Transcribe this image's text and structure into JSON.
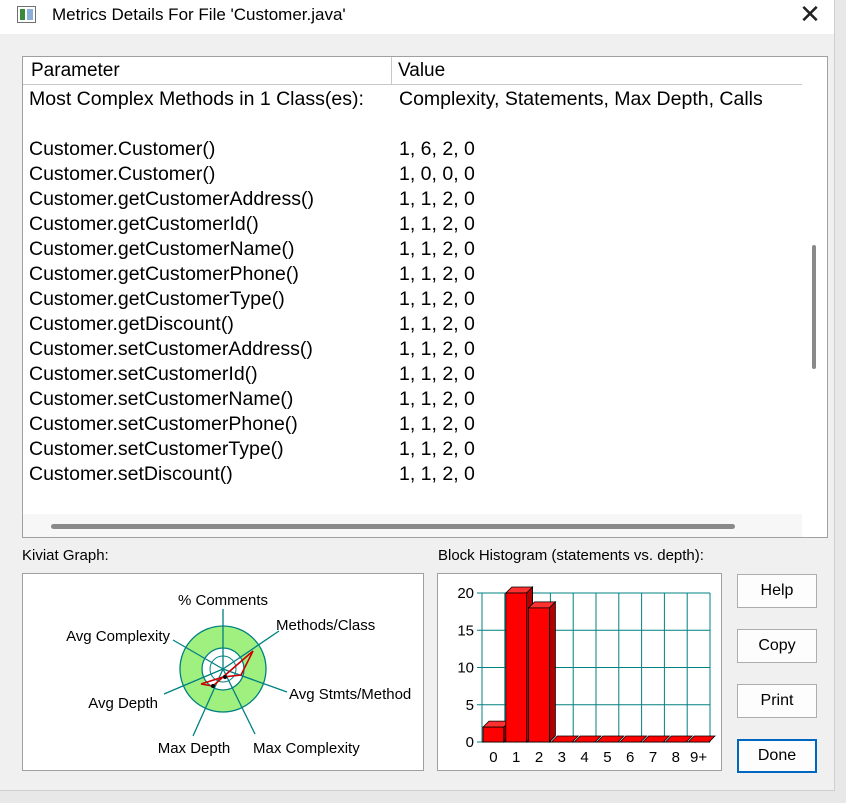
{
  "window": {
    "title": "Metrics Details For File 'Customer.java'",
    "close_glyph": "✕"
  },
  "table": {
    "headers": [
      "Parameter",
      "Value"
    ],
    "rows": [
      {
        "param": "Most Complex Methods in 1 Class(es):",
        "value": "Complexity, Statements, Max Depth, Calls"
      },
      {
        "param": "",
        "value": ""
      },
      {
        "param": "Customer.Customer()",
        "value": "1, 6, 2, 0"
      },
      {
        "param": "Customer.Customer()",
        "value": "1, 0, 0, 0"
      },
      {
        "param": "Customer.getCustomerAddress()",
        "value": "1, 1, 2, 0"
      },
      {
        "param": "Customer.getCustomerId()",
        "value": "1, 1, 2, 0"
      },
      {
        "param": "Customer.getCustomerName()",
        "value": "1, 1, 2, 0"
      },
      {
        "param": "Customer.getCustomerPhone()",
        "value": "1, 1, 2, 0"
      },
      {
        "param": "Customer.getCustomerType()",
        "value": "1, 1, 2, 0"
      },
      {
        "param": "Customer.getDiscount()",
        "value": "1, 1, 2, 0"
      },
      {
        "param": "Customer.setCustomerAddress()",
        "value": "1, 1, 2, 0"
      },
      {
        "param": "Customer.setCustomerId()",
        "value": "1, 1, 2, 0"
      },
      {
        "param": "Customer.setCustomerName()",
        "value": "1, 1, 2, 0"
      },
      {
        "param": "Customer.setCustomerPhone()",
        "value": "1, 1, 2, 0"
      },
      {
        "param": "Customer.setCustomerType()",
        "value": "1, 1, 2, 0"
      },
      {
        "param": "Customer.setDiscount()",
        "value": "1, 1, 2, 0"
      }
    ]
  },
  "kiviat": {
    "label": "Kiviat Graph:",
    "axes": [
      "% Comments",
      "Methods/Class",
      "Avg Stmts/Method",
      "Max Complexity",
      "Max Depth",
      "Avg Depth",
      "Avg Complexity"
    ],
    "colors": {
      "band": "#a0f080",
      "line": "#cc0000",
      "axis": "#008080"
    }
  },
  "histogram": {
    "label": "Block Histogram (statements vs. depth):",
    "chart_data": {
      "type": "bar",
      "categories": [
        "0",
        "1",
        "2",
        "3",
        "4",
        "5",
        "6",
        "7",
        "8",
        "9+"
      ],
      "values": [
        2,
        20,
        18,
        0,
        0,
        0,
        0,
        0,
        0,
        0
      ],
      "ylim": [
        0,
        20
      ],
      "yticks": [
        "0",
        "5",
        "10",
        "15",
        "20"
      ],
      "bar_color": "#ff0000",
      "grid_color": "#008080"
    }
  },
  "buttons": {
    "help": "Help",
    "copy": "Copy",
    "print": "Print",
    "done": "Done"
  }
}
